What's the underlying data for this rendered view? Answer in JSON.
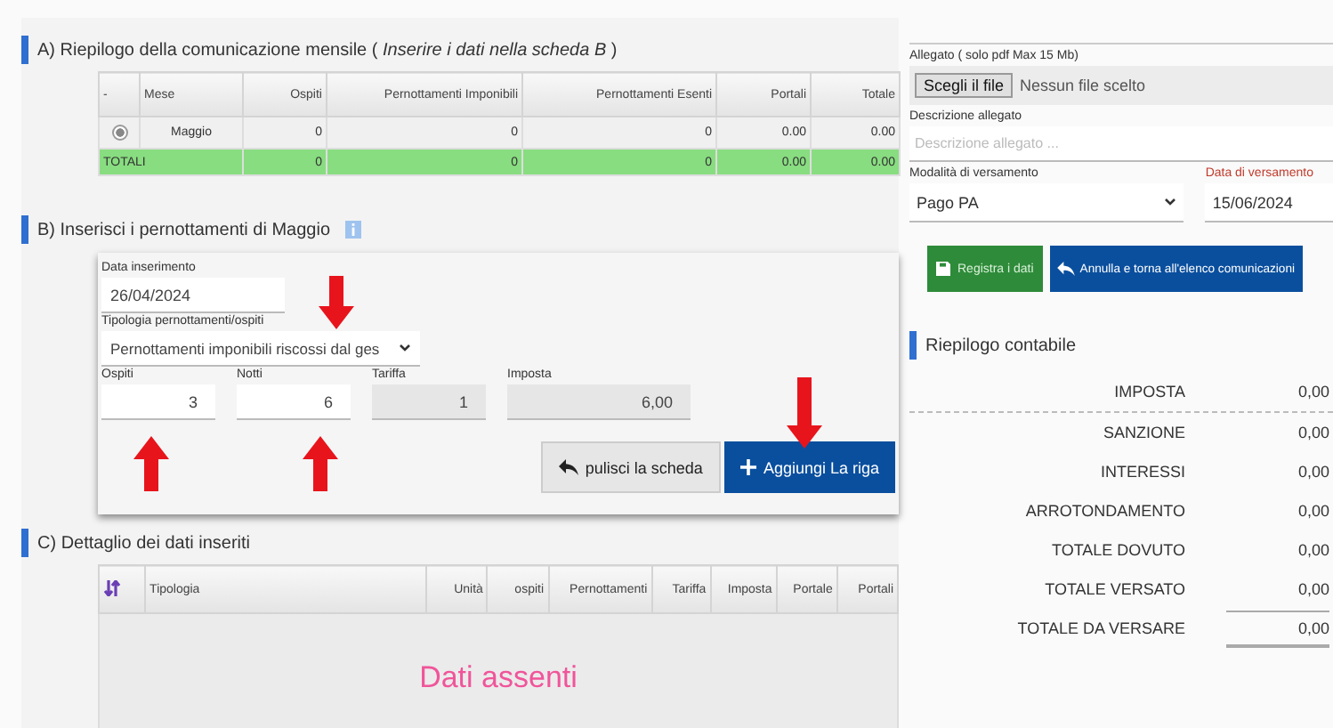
{
  "summary_section": {
    "title": "A) Riepilogo della comunicazione mensile ( *Inserire i dati nella scheda B* )",
    "columns": [
      "-",
      "Mese",
      "Ospiti",
      "Pernottamenti Imponibili",
      "Pernottamenti Esenti",
      "Portali",
      "Totale"
    ],
    "rows": [
      {
        "selected": true,
        "cells": [
          "",
          "Maggio",
          "0",
          "0",
          "0",
          "0.00",
          "0.00"
        ]
      }
    ],
    "totals": [
      "TOTALI",
      "0",
      "0",
      "0",
      "0.00",
      "0.00"
    ]
  },
  "entry_section": {
    "title": "B) Inserisci i pernottamenti di Maggio",
    "date_field": {
      "label": "Data inserimento",
      "value": "26/04/2024"
    },
    "type_field": {
      "label": "Tipologia pernottamenti/ospiti",
      "value": "Pernottamenti imponibili riscossi dal ges"
    },
    "number_fields": [
      {
        "label": "Ospiti",
        "value": "3",
        "disabled": false
      },
      {
        "label": "Notti",
        "value": "6",
        "disabled": false
      },
      {
        "label": "Tariffa",
        "value": "1",
        "disabled": true
      },
      {
        "label": "Imposta",
        "value": "6,00",
        "disabled": true
      }
    ],
    "buttons": [
      {
        "label": "pulisci la scheda",
        "kind": "reset"
      },
      {
        "label": "Aggiungi La riga",
        "kind": "add"
      }
    ]
  },
  "detail_section": {
    "title": "C) Dettaglio dei dati inseriti",
    "columns": [
      "Tipologia",
      "Unità",
      "ospiti",
      "Pernottamenti",
      "Tariffa",
      "Imposta",
      "Portale",
      "Portali"
    ],
    "empty_message": "Dati assenti"
  },
  "attachment": {
    "label": "Allegato ( solo pdf Max 15 Mb)",
    "button": "Scegli il file",
    "status": "Nessun file scelto"
  },
  "attachment_description": {
    "label": "Descrizione allegato",
    "placeholder": "Descrizione allegato ..."
  },
  "payment_mode": {
    "label": "Modalità di versamento",
    "value": "Pago PA"
  },
  "payment_date": {
    "label": "Data di versamento",
    "value": "15/06/2024"
  },
  "actions": [
    {
      "label": "Registra i dati",
      "kind": "save"
    },
    {
      "label": "Annulla e torna all'elenco comunicazioni",
      "kind": "back"
    }
  ],
  "accounting": {
    "title": "Riepilogo contabile",
    "rows": [
      {
        "label": "IMPOSTA",
        "value": "0,00"
      },
      {
        "label": "SANZIONE",
        "value": "0,00"
      },
      {
        "label": "INTERESSI",
        "value": "0,00"
      },
      {
        "label": "ARROTONDAMENTO",
        "value": "0,00"
      },
      {
        "label": "TOTALE DOVUTO",
        "value": "0,00"
      },
      {
        "label": "TOTALE VERSATO",
        "value": "0,00"
      },
      {
        "label": "TOTALE DA VERSARE",
        "value": "0,00"
      }
    ]
  }
}
